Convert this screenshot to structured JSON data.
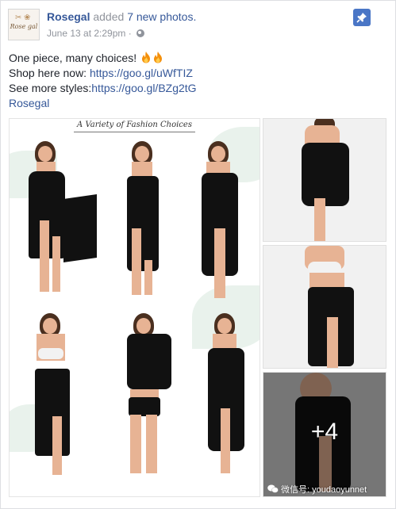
{
  "post": {
    "avatar_text": "Rose gal",
    "page_name": "Rosegal",
    "action": "added",
    "photo_count_label": "7 new photos.",
    "timestamp": "June 13 at 2:29pm",
    "separator": "·",
    "text": {
      "line1": "One piece, many choices!",
      "line2_prefix": "Shop here now: ",
      "line2_link": "https://goo.gl/uWfTIZ",
      "line3_prefix": "See more styles:",
      "line3_link": "https://goo.gl/BZg2tG",
      "line4_link": "Rosegal"
    }
  },
  "photos": {
    "collage_title": "A Variety of Fashion Choices",
    "more_count": "+4"
  },
  "watermark": "微信号: youdaoyunnet",
  "colors": {
    "link": "#365899",
    "meta": "#90949c",
    "pin": "#4a76c6"
  },
  "icons": [
    "globe-icon",
    "pin-icon",
    "fire-icon",
    "wechat-icon"
  ]
}
